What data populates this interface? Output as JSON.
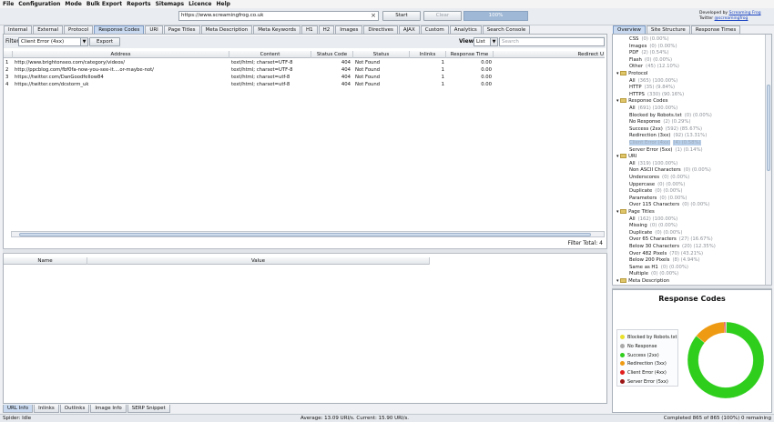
{
  "menu": [
    "File",
    "Configuration",
    "Mode",
    "Bulk Export",
    "Reports",
    "Sitemaps",
    "Licence",
    "Help"
  ],
  "toolbar": {
    "url": "https://www.screamingfrog.co.uk",
    "clear_icon": "×",
    "start": "Start",
    "clear": "Clear",
    "progress": "100%",
    "dev_line1": "Developed by",
    "dev_link": "Screaming Frog",
    "twitter_line": "Twitter",
    "twitter_handle": "@screamingfrog"
  },
  "main_tabs": [
    "Internal",
    "External",
    "Protocol",
    "Response Codes",
    "URI",
    "Page Titles",
    "Meta Description",
    "Meta Keywords",
    "H1",
    "H2",
    "Images",
    "Directives",
    "AJAX",
    "Custom",
    "Analytics",
    "Search Console"
  ],
  "active_main_tab": 3,
  "filter": {
    "label": "Filter:",
    "value": "Client Error (4xx)",
    "export": "Export",
    "view_label": "View:",
    "view_value": "List",
    "search_placeholder": "Search"
  },
  "grid": {
    "columns": [
      "Address",
      "Content",
      "Status Code",
      "Status",
      "Inlinks",
      "Response Time",
      "Redirect U"
    ],
    "rows": [
      {
        "n": "1",
        "address": "http://www.brightonseo.com/category/videos/",
        "content": "text/html; charset=UTF-8",
        "code": "404",
        "status": "Not Found",
        "inlinks": "1",
        "time": "0.00"
      },
      {
        "n": "2",
        "address": "http://ppcblog.com/fbf0fa-now-you-see-it....or-maybe-not/",
        "content": "text/html; charset=UTF-8",
        "code": "404",
        "status": "Not Found",
        "inlinks": "1",
        "time": "0.00"
      },
      {
        "n": "3",
        "address": "https://twitter.com/DanGoodfellow84",
        "content": "text/html; charset=utf-8",
        "code": "404",
        "status": "Not Found",
        "inlinks": "1",
        "time": "0.00"
      },
      {
        "n": "4",
        "address": "https://twitter.com/dcstorm_uk",
        "content": "text/html; charset=utf-8",
        "code": "404",
        "status": "Not Found",
        "inlinks": "1",
        "time": "0.00"
      }
    ],
    "filter_total_label": "Filter Total:",
    "filter_total": "4"
  },
  "details": {
    "columns": [
      "Name",
      "Value"
    ]
  },
  "bottom_tabs": [
    "URL Info",
    "Inlinks",
    "Outlinks",
    "Image Info",
    "SERP Snippet"
  ],
  "status_bar": {
    "left": "Spider: Idle",
    "center": "Average: 13.09 URI/s. Current: 15.90 URI/s.",
    "right": "Completed 865 of 865 (100%) 0 remaining"
  },
  "right_tabs": [
    "Overview",
    "Site Structure",
    "Response Times"
  ],
  "tree": [
    {
      "indent": 2,
      "label": "CSS",
      "count": "(0) (0.00%)"
    },
    {
      "indent": 2,
      "label": "Images",
      "count": "(0) (0.00%)"
    },
    {
      "indent": 2,
      "label": "PDF",
      "count": "(2) (0.54%)"
    },
    {
      "indent": 2,
      "label": "Flash",
      "count": "(0) (0.00%)"
    },
    {
      "indent": 2,
      "label": "Other",
      "count": "(45) (12.10%)"
    },
    {
      "indent": 1,
      "label": "Protocol",
      "count": "",
      "folder": true
    },
    {
      "indent": 2,
      "label": "All",
      "count": "(365) (100.00%)"
    },
    {
      "indent": 2,
      "label": "HTTP",
      "count": "(35) (9.84%)"
    },
    {
      "indent": 2,
      "label": "HTTPS",
      "count": "(330) (90.16%)"
    },
    {
      "indent": 1,
      "label": "Response Codes",
      "count": "",
      "folder": true
    },
    {
      "indent": 2,
      "label": "All",
      "count": "(691) (100.00%)"
    },
    {
      "indent": 2,
      "label": "Blocked by Robots.txt",
      "count": "(0) (0.00%)"
    },
    {
      "indent": 2,
      "label": "No Response",
      "count": "(2) (0.29%)"
    },
    {
      "indent": 2,
      "label": "Success (2xx)",
      "count": "(592) (85.67%)"
    },
    {
      "indent": 2,
      "label": "Redirection (3xx)",
      "count": "(92) (13.31%)"
    },
    {
      "indent": 2,
      "label": "Client Error (4xx)",
      "count": "(4) (0.58%)",
      "selected": true
    },
    {
      "indent": 2,
      "label": "Server Error (5xx)",
      "count": "(1) (0.14%)"
    },
    {
      "indent": 1,
      "label": "URI",
      "count": "",
      "folder": true
    },
    {
      "indent": 2,
      "label": "All",
      "count": "(319) (100.00%)"
    },
    {
      "indent": 2,
      "label": "Non ASCII Characters",
      "count": "(0) (0.00%)"
    },
    {
      "indent": 2,
      "label": "Underscores",
      "count": "(0) (0.00%)"
    },
    {
      "indent": 2,
      "label": "Uppercase",
      "count": "(0) (0.00%)"
    },
    {
      "indent": 2,
      "label": "Duplicate",
      "count": "(0) (0.00%)"
    },
    {
      "indent": 2,
      "label": "Parameters",
      "count": "(0) (0.00%)"
    },
    {
      "indent": 2,
      "label": "Over 115 Characters",
      "count": "(0) (0.00%)"
    },
    {
      "indent": 1,
      "label": "Page Titles",
      "count": "",
      "folder": true
    },
    {
      "indent": 2,
      "label": "All",
      "count": "(162) (100.00%)"
    },
    {
      "indent": 2,
      "label": "Missing",
      "count": "(0) (0.00%)"
    },
    {
      "indent": 2,
      "label": "Duplicate",
      "count": "(0) (0.00%)"
    },
    {
      "indent": 2,
      "label": "Over 65 Characters",
      "count": "(27) (16.67%)"
    },
    {
      "indent": 2,
      "label": "Below 30 Characters",
      "count": "(20) (12.35%)"
    },
    {
      "indent": 2,
      "label": "Over 482 Pixels",
      "count": "(70) (43.21%)"
    },
    {
      "indent": 2,
      "label": "Below 200 Pixels",
      "count": "(8) (4.94%)"
    },
    {
      "indent": 2,
      "label": "Same as H1",
      "count": "(0) (0.00%)"
    },
    {
      "indent": 2,
      "label": "Multiple",
      "count": "(0) (0.00%)"
    },
    {
      "indent": 1,
      "label": "Meta Description",
      "count": "",
      "folder": true
    }
  ],
  "chart_data": {
    "type": "pie",
    "title": "Response Codes",
    "categories": [
      "Blocked by Robots.txt",
      "No Response",
      "Success (2xx)",
      "Redirection (3xx)",
      "Client Error (4xx)",
      "Server Error (5xx)"
    ],
    "values": [
      0,
      2,
      592,
      92,
      4,
      1
    ],
    "colors": [
      "#e8e02a",
      "#a9a9a9",
      "#2fce1d",
      "#ee9a12",
      "#e21d1d",
      "#9c1414"
    ],
    "legend_position": "left"
  }
}
